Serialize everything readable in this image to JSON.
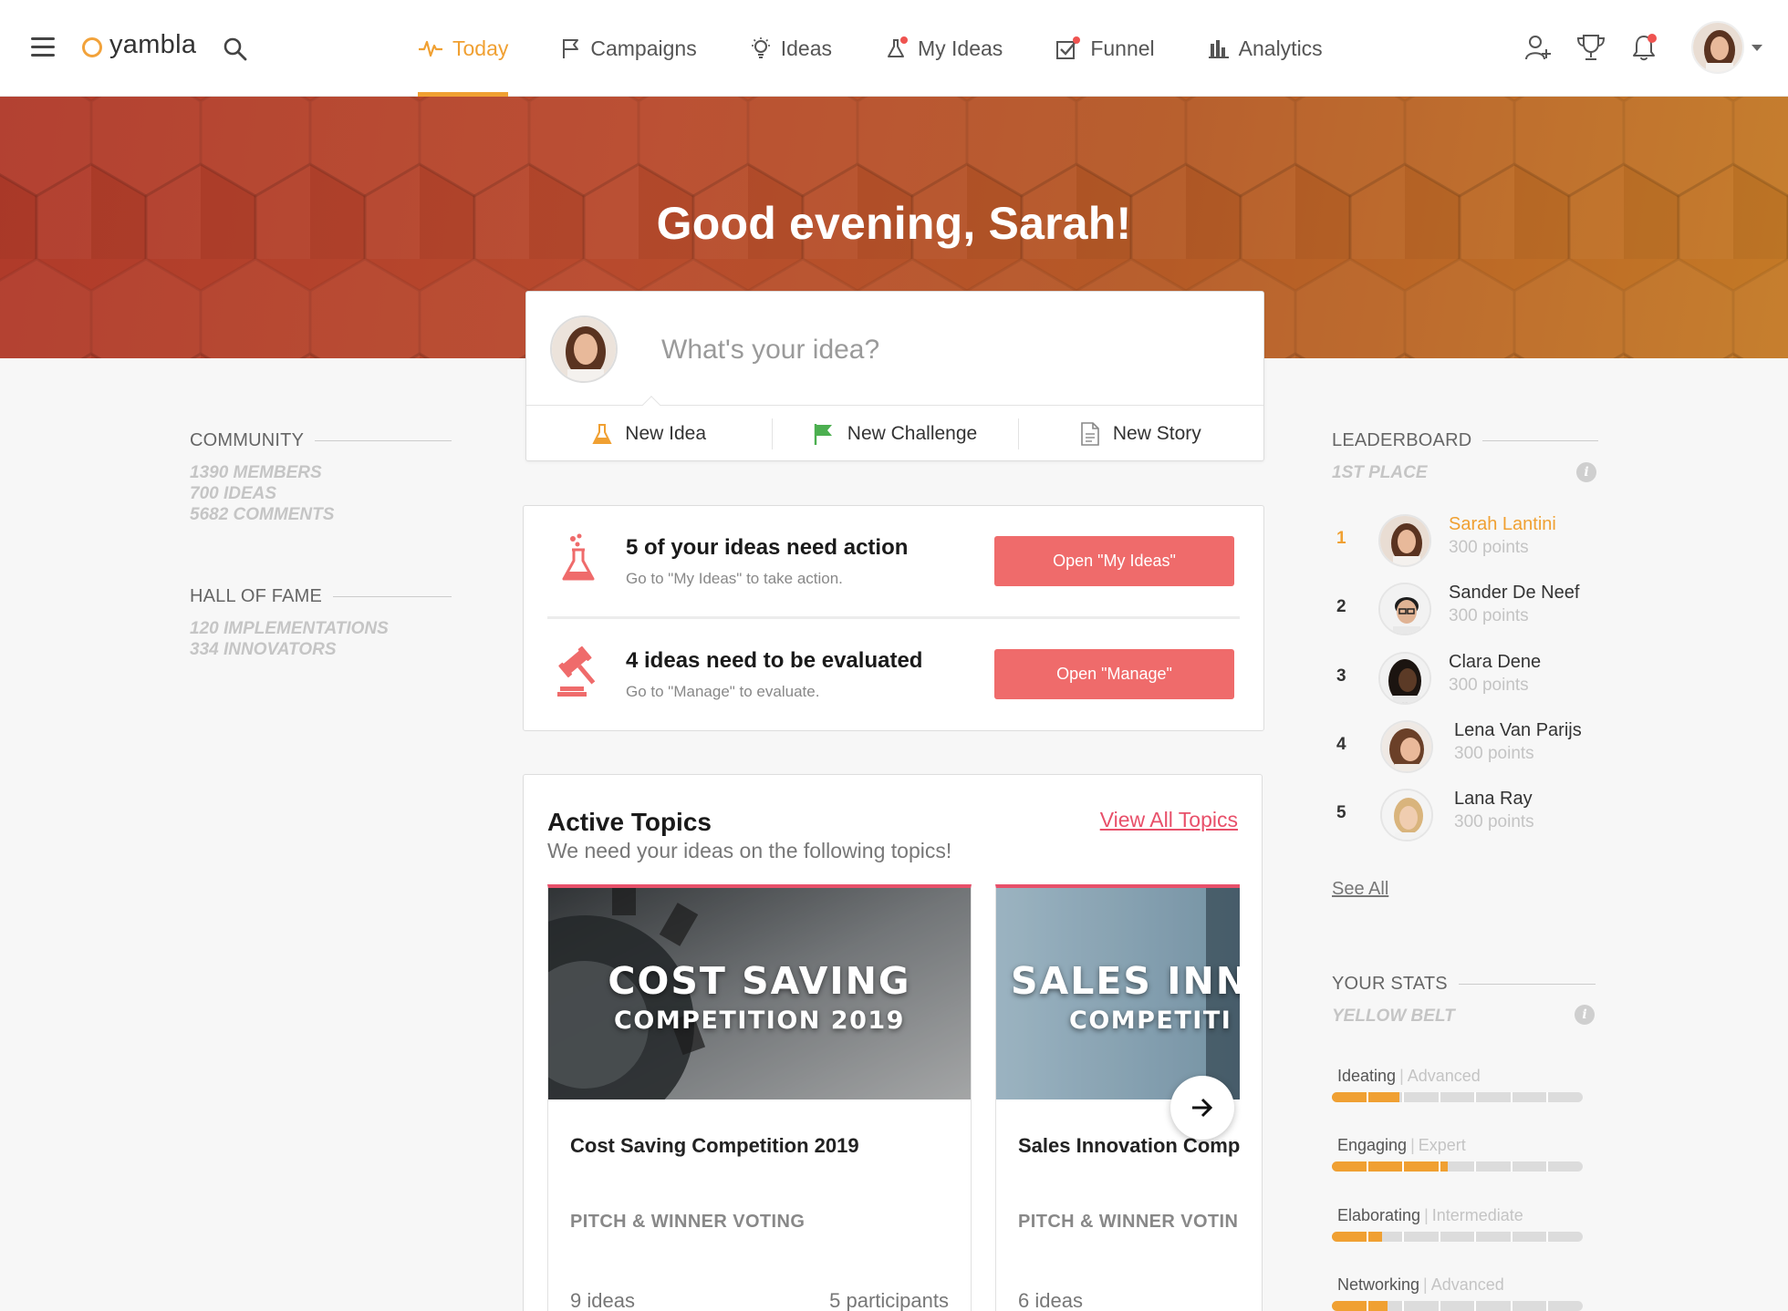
{
  "brand": {
    "name": "yambla",
    "accent": "#f0a032",
    "danger": "#ef6b6b",
    "link": "#e8506a"
  },
  "nav": {
    "items": [
      {
        "label": "Today",
        "icon": "pulse-icon",
        "active": true
      },
      {
        "label": "Campaigns",
        "icon": "flag-icon"
      },
      {
        "label": "Ideas",
        "icon": "lightbulb-icon"
      },
      {
        "label": "My Ideas",
        "icon": "flask-icon",
        "badge": true
      },
      {
        "label": "Funnel",
        "icon": "checkbox-icon",
        "badge": true
      },
      {
        "label": "Analytics",
        "icon": "bar-chart-icon"
      }
    ],
    "right_icons": [
      "add-user-icon",
      "trophy-icon",
      "bell-icon"
    ]
  },
  "hero": {
    "greeting": "Good evening, Sarah!"
  },
  "composer": {
    "placeholder": "What's your idea?",
    "actions": [
      {
        "label": "New Idea",
        "icon": "flask-icon"
      },
      {
        "label": "New Challenge",
        "icon": "green-flag-icon"
      },
      {
        "label": "New Story",
        "icon": "document-icon"
      }
    ]
  },
  "community": {
    "heading": "COMMUNITY",
    "lines": [
      "1390 MEMBERS",
      "700 IDEAS",
      "5682 COMMENTS"
    ]
  },
  "hall_of_fame": {
    "heading": "HALL OF FAME",
    "lines": [
      "120 IMPLEMENTATIONS",
      "334 INNOVATORS"
    ]
  },
  "actions": [
    {
      "title": "5 of your ideas need action",
      "subtitle": "Go to \"My Ideas\" to take action.",
      "button": "Open \"My Ideas\"",
      "icon": "flask-icon"
    },
    {
      "title": "4 ideas need to be evaluated",
      "subtitle": "Go to \"Manage\" to evaluate.",
      "button": "Open \"Manage\"",
      "icon": "gavel-icon"
    }
  ],
  "topics": {
    "title": "Active Topics",
    "subtitle": "We need your ideas on the following topics!",
    "view_all": "View All Topics",
    "cards": [
      {
        "overlay1": "COST SAVING",
        "overlay2": "COMPETITION 2019",
        "name": "Cost Saving Competition 2019",
        "phase": "PITCH & WINNER VOTING",
        "ideas": "9 ideas",
        "participants": "5 participants"
      },
      {
        "overlay1": "SALES INNO",
        "overlay2": "COMPETITI",
        "name": "Sales Innovation Comp",
        "phase": "PITCH & WINNER VOTIN",
        "ideas": "6 ideas",
        "participants": ""
      }
    ]
  },
  "leaderboard": {
    "heading": "LEADERBOARD",
    "subheading": "1ST PLACE",
    "see_all": "See All",
    "entries": [
      {
        "rank": "1",
        "name": "Sarah Lantini",
        "points": "300 points"
      },
      {
        "rank": "2",
        "name": "Sander De Neef",
        "points": "300 points"
      },
      {
        "rank": "3",
        "name": "Clara Dene",
        "points": "300 points"
      },
      {
        "rank": "4",
        "name": "Lena Van Parijs",
        "points": "300 points"
      },
      {
        "rank": "5",
        "name": "Lana Ray",
        "points": "300 points"
      }
    ]
  },
  "stats": {
    "heading": "YOUR STATS",
    "subheading": "YELLOW BELT",
    "items": [
      {
        "name": "Ideating",
        "level": "Advanced",
        "progress": 0.27
      },
      {
        "name": "Engaging",
        "level": "Expert",
        "progress": 0.46
      },
      {
        "name": "Elaborating",
        "level": "Intermediate",
        "progress": 0.2
      },
      {
        "name": "Networking",
        "level": "Advanced",
        "progress": 0.22
      }
    ]
  }
}
